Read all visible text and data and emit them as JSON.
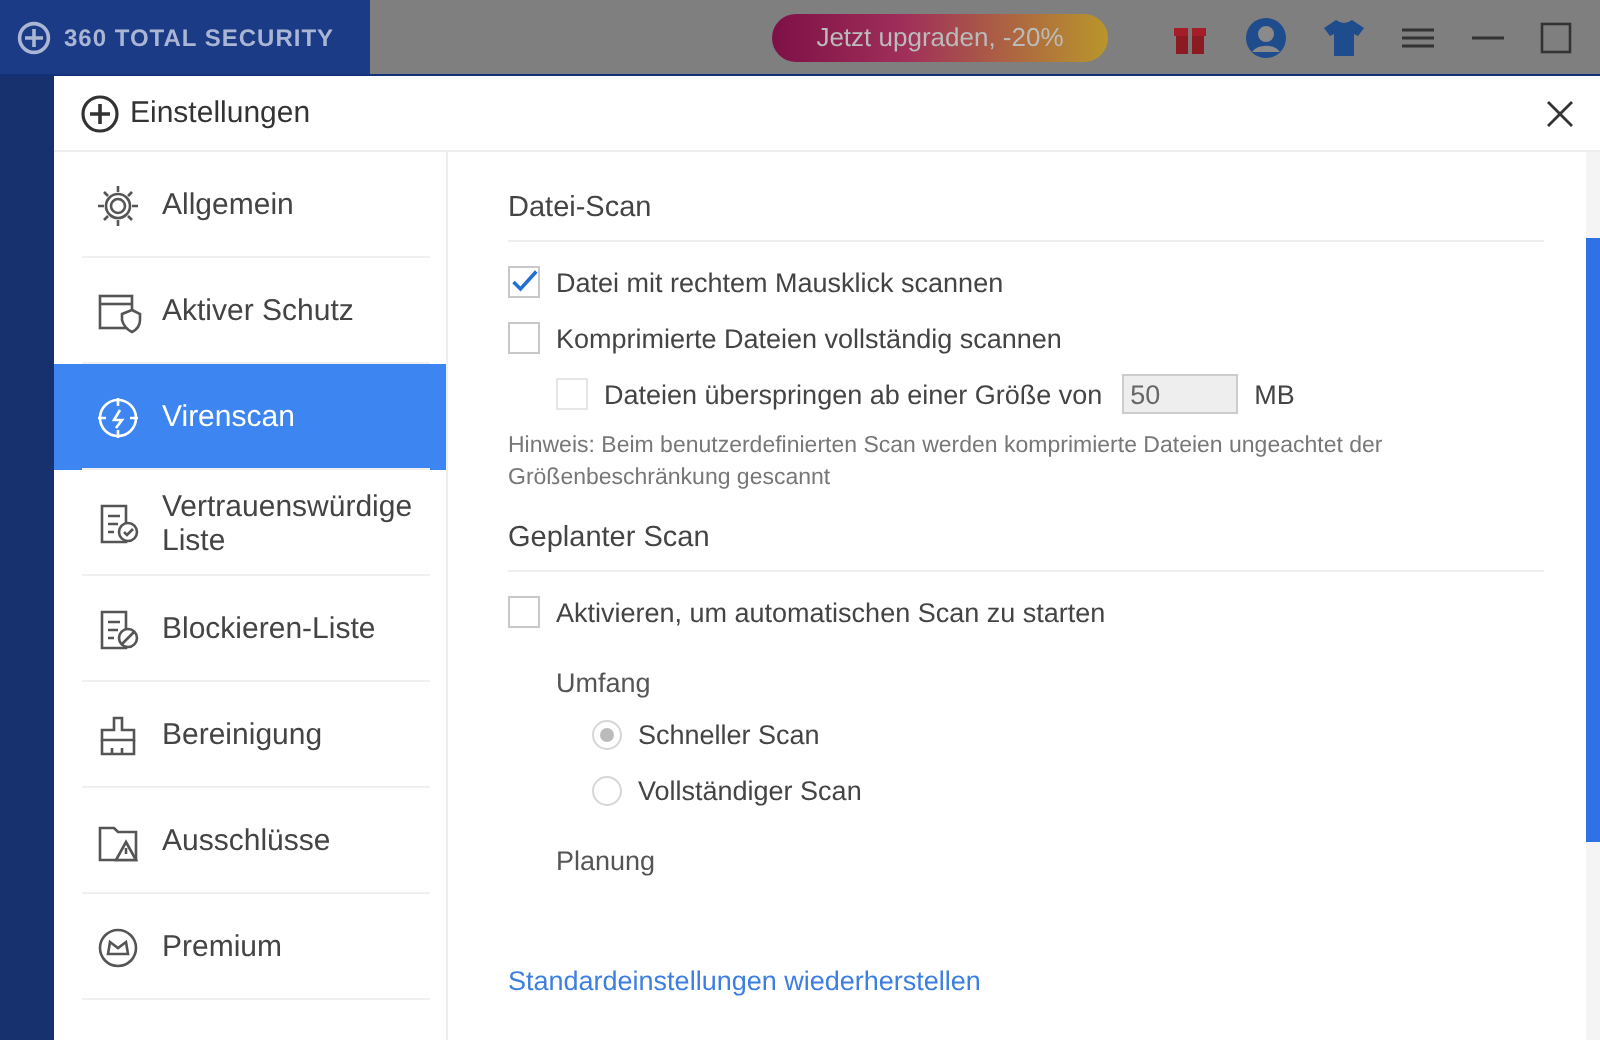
{
  "app": {
    "logo": "360 TOTAL SECURITY",
    "upgrade_button": "Jetzt upgraden, -20%"
  },
  "dialog": {
    "title": "Einstellungen"
  },
  "sidebar": {
    "items": [
      {
        "label": "Allgemein",
        "selected": false
      },
      {
        "label": "Aktiver Schutz",
        "selected": false
      },
      {
        "label": "Virenscan",
        "selected": true
      },
      {
        "label": "Vertrauenswürdige Liste",
        "selected": false
      },
      {
        "label": "Blockieren-Liste",
        "selected": false
      },
      {
        "label": "Bereinigung",
        "selected": false
      },
      {
        "label": "Ausschlüsse",
        "selected": false
      },
      {
        "label": "Premium",
        "selected": false
      }
    ]
  },
  "sections": [
    {
      "title": "Datei-Scan",
      "options": [
        {
          "kind": "checkbox",
          "label": "Datei mit rechtem Mausklick scannen",
          "checked": true,
          "disabled": false
        },
        {
          "kind": "checkbox",
          "label": "Komprimierte Dateien vollständig scannen",
          "checked": false,
          "disabled": false,
          "children": [
            {
              "kind": "size",
              "label": "Dateien überspringen ab einer Größe von",
              "checked": false,
              "disabled": true,
              "value": "50",
              "unit": "MB"
            }
          ]
        },
        {
          "kind": "note",
          "label": "Hinweis: Beim benutzerdefinierten Scan werden komprimierte Dateien ungeachtet der Größenbeschränkung gescannt"
        }
      ]
    },
    {
      "title": "Geplanter Scan",
      "options": [
        {
          "kind": "checkbox",
          "label": "Aktivieren, um automatischen Scan zu starten",
          "checked": false,
          "disabled": false
        },
        {
          "kind": "group",
          "label": "Umfang",
          "children": [
            {
              "kind": "radio",
              "label": "Schneller Scan",
              "selected": true,
              "disabled": true
            },
            {
              "kind": "radio",
              "label": "Vollständiger Scan",
              "selected": false,
              "disabled": true
            }
          ]
        },
        {
          "kind": "group",
          "label": "Planung"
        }
      ]
    }
  ],
  "footer_link": "Standardeinstellungen wiederherstellen"
}
